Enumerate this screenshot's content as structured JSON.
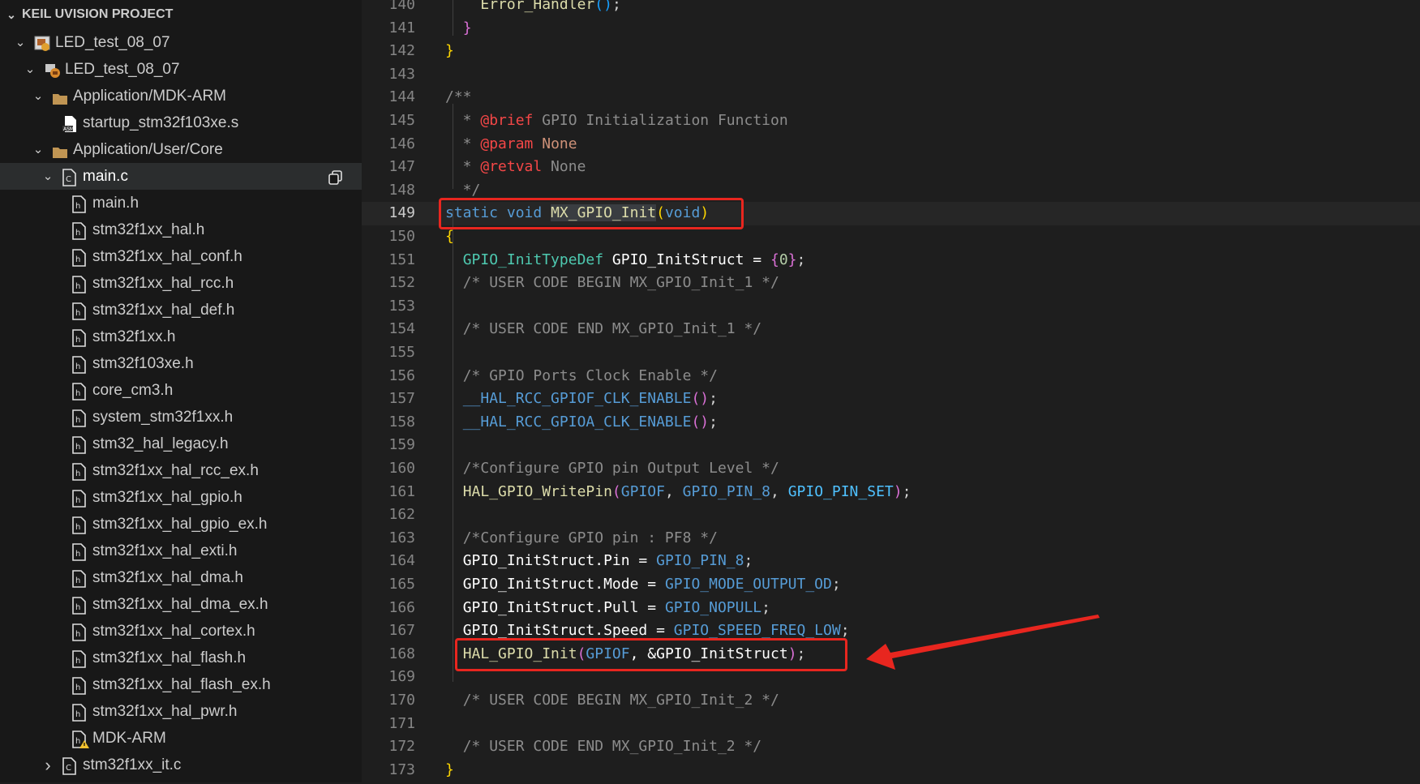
{
  "sidebar": {
    "title": "KEIL UVISION PROJECT",
    "items": [
      {
        "label": "LED_test_08_07",
        "icon": "project-icon",
        "chev": "v",
        "level": 0
      },
      {
        "label": "LED_test_08_07",
        "icon": "target-icon",
        "chev": "v",
        "level": 1
      },
      {
        "label": "Application/MDK-ARM",
        "icon": "folder-icon",
        "chev": "v",
        "level": 2
      },
      {
        "label": "startup_stm32f103xe.s",
        "icon": "asm-file-icon",
        "chev": "",
        "level": 3
      },
      {
        "label": "Application/User/Core",
        "icon": "folder-icon",
        "chev": "v",
        "level": 2
      },
      {
        "label": "main.c",
        "icon": "c-file-icon",
        "chev": "v",
        "level": 3,
        "selected": true
      },
      {
        "label": "main.h",
        "icon": "h-file-icon",
        "chev": "",
        "level": 4
      },
      {
        "label": "stm32f1xx_hal.h",
        "icon": "h-file-icon",
        "chev": "",
        "level": 4
      },
      {
        "label": "stm32f1xx_hal_conf.h",
        "icon": "h-file-icon",
        "chev": "",
        "level": 4
      },
      {
        "label": "stm32f1xx_hal_rcc.h",
        "icon": "h-file-icon",
        "chev": "",
        "level": 4
      },
      {
        "label": "stm32f1xx_hal_def.h",
        "icon": "h-file-icon",
        "chev": "",
        "level": 4
      },
      {
        "label": "stm32f1xx.h",
        "icon": "h-file-icon",
        "chev": "",
        "level": 4
      },
      {
        "label": "stm32f103xe.h",
        "icon": "h-file-icon",
        "chev": "",
        "level": 4
      },
      {
        "label": "core_cm3.h",
        "icon": "h-file-icon",
        "chev": "",
        "level": 4
      },
      {
        "label": "system_stm32f1xx.h",
        "icon": "h-file-icon",
        "chev": "",
        "level": 4
      },
      {
        "label": "stm32_hal_legacy.h",
        "icon": "h-file-icon",
        "chev": "",
        "level": 4
      },
      {
        "label": "stm32f1xx_hal_rcc_ex.h",
        "icon": "h-file-icon",
        "chev": "",
        "level": 4
      },
      {
        "label": "stm32f1xx_hal_gpio.h",
        "icon": "h-file-icon",
        "chev": "",
        "level": 4
      },
      {
        "label": "stm32f1xx_hal_gpio_ex.h",
        "icon": "h-file-icon",
        "chev": "",
        "level": 4
      },
      {
        "label": "stm32f1xx_hal_exti.h",
        "icon": "h-file-icon",
        "chev": "",
        "level": 4
      },
      {
        "label": "stm32f1xx_hal_dma.h",
        "icon": "h-file-icon",
        "chev": "",
        "level": 4
      },
      {
        "label": "stm32f1xx_hal_dma_ex.h",
        "icon": "h-file-icon",
        "chev": "",
        "level": 4
      },
      {
        "label": "stm32f1xx_hal_cortex.h",
        "icon": "h-file-icon",
        "chev": "",
        "level": 4
      },
      {
        "label": "stm32f1xx_hal_flash.h",
        "icon": "h-file-icon",
        "chev": "",
        "level": 4
      },
      {
        "label": "stm32f1xx_hal_flash_ex.h",
        "icon": "h-file-icon",
        "chev": "",
        "level": 4
      },
      {
        "label": "stm32f1xx_hal_pwr.h",
        "icon": "h-file-icon",
        "chev": "",
        "level": 4
      },
      {
        "label": "MDK-ARM",
        "icon": "warning-file-icon",
        "chev": "",
        "level": 4
      },
      {
        "label": "stm32f1xx_it.c",
        "icon": "c-file-icon",
        "chev": ">",
        "level": 3
      }
    ]
  },
  "editor": {
    "current_line": "149",
    "lines": [
      {
        "n": "140",
        "tokens": [
          [
            "    ",
            ""
          ],
          [
            "Error_Handler",
            "t-fn"
          ],
          [
            "()",
            "t-br3"
          ],
          [
            ";",
            ""
          ]
        ]
      },
      {
        "n": "141",
        "tokens": [
          [
            "  ",
            ""
          ],
          [
            "}",
            "t-br2"
          ]
        ]
      },
      {
        "n": "142",
        "tokens": [
          [
            "}",
            "t-br1"
          ]
        ]
      },
      {
        "n": "143",
        "tokens": []
      },
      {
        "n": "144",
        "tokens": [
          [
            "/**",
            "t-com2"
          ]
        ]
      },
      {
        "n": "145",
        "tokens": [
          [
            "  * ",
            "t-com2"
          ],
          [
            "@brief",
            "t-tag"
          ],
          [
            " GPIO Initialization Function",
            "t-com2"
          ]
        ]
      },
      {
        "n": "146",
        "tokens": [
          [
            "  * ",
            "t-com2"
          ],
          [
            "@param",
            "t-tag"
          ],
          [
            " ",
            "t-com2"
          ],
          [
            "None",
            "t-tagarg"
          ]
        ]
      },
      {
        "n": "147",
        "tokens": [
          [
            "  * ",
            "t-com2"
          ],
          [
            "@retval",
            "t-tag"
          ],
          [
            " None",
            "t-com2"
          ]
        ]
      },
      {
        "n": "148",
        "tokens": [
          [
            "  */",
            "t-com2"
          ]
        ]
      },
      {
        "n": "149",
        "tokens": [
          [
            "static",
            "t-kw"
          ],
          [
            " ",
            ""
          ],
          [
            "void",
            "t-kw"
          ],
          [
            " ",
            ""
          ],
          [
            "MX_GPIO_Init",
            "t-fnhi"
          ],
          [
            "(",
            "t-br1"
          ],
          [
            "void",
            "t-kw"
          ],
          [
            ")",
            "t-br1"
          ]
        ]
      },
      {
        "n": "150",
        "tokens": [
          [
            "{",
            "t-br1"
          ]
        ]
      },
      {
        "n": "151",
        "tokens": [
          [
            "  ",
            ""
          ],
          [
            "GPIO_InitTypeDef",
            "t-type"
          ],
          [
            " GPIO_InitStruct = ",
            "t-var"
          ],
          [
            "{",
            "t-br2"
          ],
          [
            "0",
            "t-num"
          ],
          [
            "}",
            "t-br2"
          ],
          [
            ";",
            ""
          ]
        ]
      },
      {
        "n": "152",
        "tokens": [
          [
            "  ",
            ""
          ],
          [
            "/* USER CODE BEGIN MX_GPIO_Init_1 */",
            "t-com2"
          ]
        ]
      },
      {
        "n": "153",
        "tokens": []
      },
      {
        "n": "154",
        "tokens": [
          [
            "  ",
            ""
          ],
          [
            "/* USER CODE END MX_GPIO_Init_1 */",
            "t-com2"
          ]
        ]
      },
      {
        "n": "155",
        "tokens": []
      },
      {
        "n": "156",
        "tokens": [
          [
            "  ",
            ""
          ],
          [
            "/* GPIO Ports Clock Enable */",
            "t-com2"
          ]
        ]
      },
      {
        "n": "157",
        "tokens": [
          [
            "  ",
            ""
          ],
          [
            "__HAL_RCC_GPIOF_CLK_ENABLE",
            "t-mac2"
          ],
          [
            "()",
            "t-br2"
          ],
          [
            ";",
            ""
          ]
        ]
      },
      {
        "n": "158",
        "tokens": [
          [
            "  ",
            ""
          ],
          [
            "__HAL_RCC_GPIOA_CLK_ENABLE",
            "t-mac2"
          ],
          [
            "()",
            "t-br2"
          ],
          [
            ";",
            ""
          ]
        ]
      },
      {
        "n": "159",
        "tokens": []
      },
      {
        "n": "160",
        "tokens": [
          [
            "  ",
            ""
          ],
          [
            "/*Configure GPIO pin Output Level */",
            "t-com2"
          ]
        ]
      },
      {
        "n": "161",
        "tokens": [
          [
            "  ",
            ""
          ],
          [
            "HAL_GPIO_WritePin",
            "t-fn"
          ],
          [
            "(",
            "t-br2"
          ],
          [
            "GPIOF",
            "t-mac2"
          ],
          [
            ", ",
            ""
          ],
          [
            "GPIO_PIN_8",
            "t-mac2"
          ],
          [
            ", ",
            ""
          ],
          [
            "GPIO_PIN_SET",
            "t-mac"
          ],
          [
            ")",
            "t-br2"
          ],
          [
            ";",
            ""
          ]
        ]
      },
      {
        "n": "162",
        "tokens": []
      },
      {
        "n": "163",
        "tokens": [
          [
            "  ",
            ""
          ],
          [
            "/*Configure GPIO pin : PF8 */",
            "t-com2"
          ]
        ]
      },
      {
        "n": "164",
        "tokens": [
          [
            "  ",
            ""
          ],
          [
            "GPIO_InitStruct.Pin = ",
            "t-var"
          ],
          [
            "GPIO_PIN_8",
            "t-mac2"
          ],
          [
            ";",
            ""
          ]
        ]
      },
      {
        "n": "165",
        "tokens": [
          [
            "  ",
            ""
          ],
          [
            "GPIO_InitStruct.Mode = ",
            "t-var"
          ],
          [
            "GPIO_MODE_OUTPUT_OD",
            "t-mac2"
          ],
          [
            ";",
            ""
          ]
        ]
      },
      {
        "n": "166",
        "tokens": [
          [
            "  ",
            ""
          ],
          [
            "GPIO_InitStruct.Pull = ",
            "t-var"
          ],
          [
            "GPIO_NOPULL",
            "t-mac2"
          ],
          [
            ";",
            ""
          ]
        ]
      },
      {
        "n": "167",
        "tokens": [
          [
            "  ",
            ""
          ],
          [
            "GPIO_InitStruct.Speed = ",
            "t-var"
          ],
          [
            "GPIO_SPEED_FREQ_LOW",
            "t-mac2"
          ],
          [
            ";",
            ""
          ]
        ]
      },
      {
        "n": "168",
        "tokens": [
          [
            "  ",
            ""
          ],
          [
            "HAL_GPIO_Init",
            "t-fn"
          ],
          [
            "(",
            "t-br2"
          ],
          [
            "GPIOF",
            "t-mac2"
          ],
          [
            ", &GPIO_InitStruct",
            "t-var"
          ],
          [
            ")",
            "t-br2"
          ],
          [
            ";",
            ""
          ]
        ]
      },
      {
        "n": "169",
        "tokens": []
      },
      {
        "n": "170",
        "tokens": [
          [
            "  ",
            ""
          ],
          [
            "/* USER CODE BEGIN MX_GPIO_Init_2 */",
            "t-com2"
          ]
        ]
      },
      {
        "n": "171",
        "tokens": []
      },
      {
        "n": "172",
        "tokens": [
          [
            "  ",
            ""
          ],
          [
            "/* USER CODE END MX_GPIO_Init_2 */",
            "t-com2"
          ]
        ]
      },
      {
        "n": "173",
        "tokens": [
          [
            "}",
            "t-br1"
          ]
        ]
      }
    ]
  },
  "annotations": {
    "highlight_color": "#e8261f"
  }
}
